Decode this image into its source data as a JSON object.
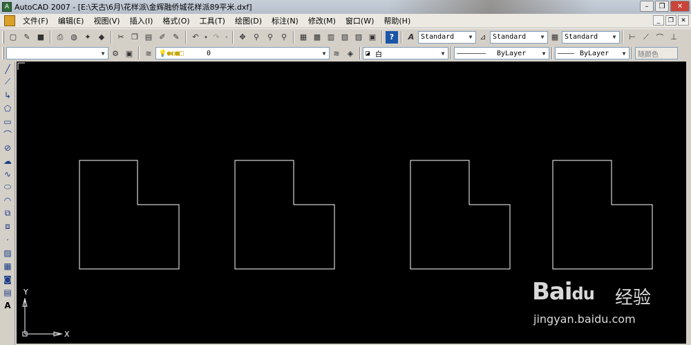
{
  "titlebar": {
    "title": "AutoCAD 2007 - [E:\\天古\\6月\\花样派\\金辉融侨城花样派89平米.dxf]",
    "minimize": "–",
    "restore": "❐",
    "close": "✕"
  },
  "menubar": {
    "items": [
      "文件(F)",
      "编辑(E)",
      "视图(V)",
      "插入(I)",
      "格式(O)",
      "工具(T)",
      "绘图(D)",
      "标注(N)",
      "修改(M)",
      "窗口(W)",
      "帮助(H)"
    ],
    "mdi_minimize": "_",
    "mdi_restore": "❐",
    "mdi_close": "✕"
  },
  "toolbar1": {
    "text_style": "Standard",
    "dim_style": "Standard",
    "table_style": "Standard"
  },
  "toolbar2": {
    "workspace": "",
    "layer": "0",
    "color": "白",
    "linetype": "ByLayer",
    "lineweight": "ByLayer",
    "plotstyle": "随颜色"
  },
  "canvas": {
    "ucs_y": "Y",
    "ucs_x": "X",
    "background": "#000000",
    "line_color": "#ffffff"
  },
  "watermark": {
    "logo": "Bai",
    "paw": "du",
    "text": "经验",
    "url": "jingyan.baidu.com"
  }
}
